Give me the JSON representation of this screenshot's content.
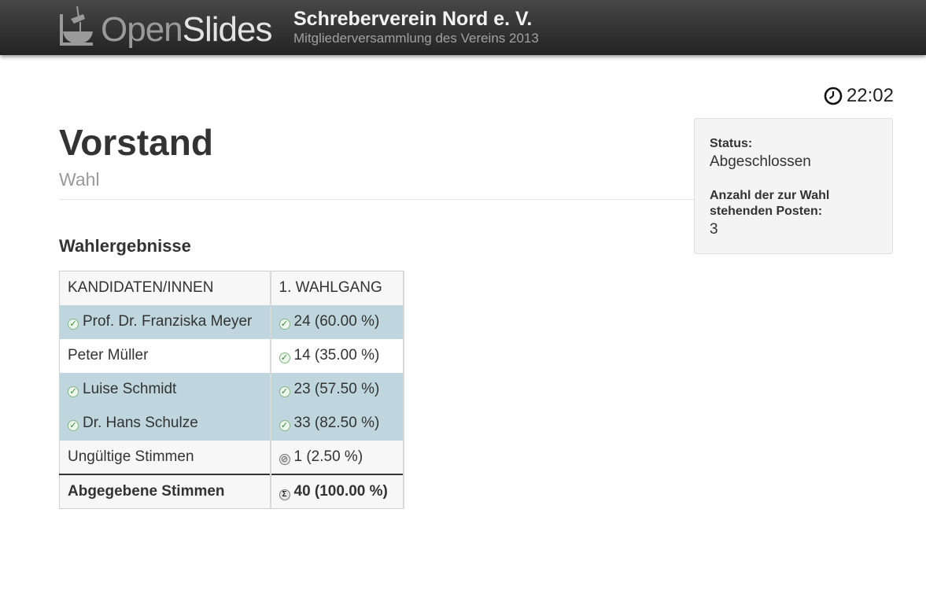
{
  "header": {
    "logo": {
      "part1": "Open",
      "part2": "Slides"
    },
    "event_name": "Schreberverein Nord e. V.",
    "event_description": "Mitgliederversammlung des Vereins 2013"
  },
  "clock": {
    "icon": "clock-icon",
    "time": "22:02"
  },
  "status_box": {
    "status_label": "Status:",
    "status_value": "Abgeschlossen",
    "posts_label": "Anzahl der zur Wahl stehenden Posten:",
    "posts_value": "3"
  },
  "slide": {
    "title": "Vorstand",
    "subtitle": "Wahl",
    "results_heading": "Wahlergebnisse"
  },
  "results_table": {
    "headers": [
      "KANDIDATEN/INNEN",
      "1. WAHLGANG"
    ],
    "rows": [
      {
        "candidate": "Prof. Dr. Franziska Meyer",
        "votes": "24 (60.00 %)",
        "elected": true
      },
      {
        "candidate": "Peter Müller",
        "votes": "14 (35.00 %)",
        "elected": false
      },
      {
        "candidate": "Luise Schmidt",
        "votes": "23 (57.50 %)",
        "elected": true
      },
      {
        "candidate": "Dr. Hans Schulze",
        "votes": "33 (82.50 %)",
        "elected": true
      }
    ],
    "invalid": {
      "label": "Ungültige Stimmen",
      "votes": "1 (2.50 %)"
    },
    "cast": {
      "label": "Abgegebene Stimmen",
      "votes": "40 (100.00 %)"
    }
  },
  "colors": {
    "elected_row": "#bfd6df",
    "header_bar": "#2e2e2e"
  }
}
